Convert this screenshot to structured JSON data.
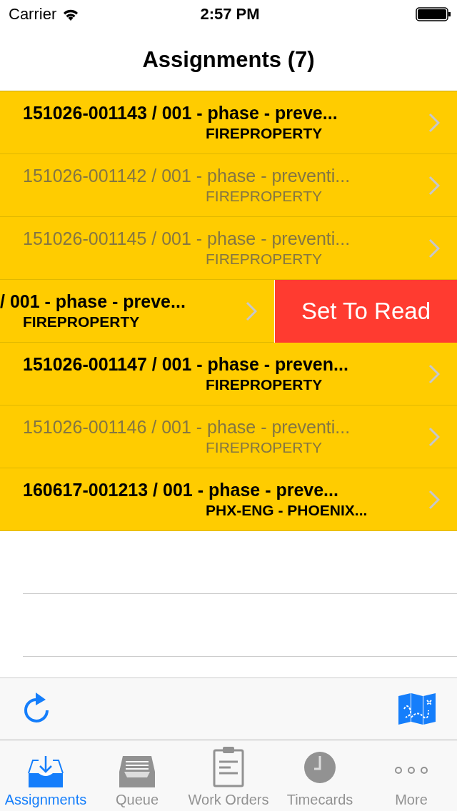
{
  "status_bar": {
    "carrier": "Carrier",
    "time": "2:57 PM"
  },
  "nav": {
    "title": "Assignments (7)"
  },
  "rows": [
    {
      "kind": "normal",
      "title": "151026-001143 / 001 - phase - preve...",
      "subtitle": "FIREPROPERTY",
      "read": false
    },
    {
      "kind": "normal",
      "title": "151026-001142 / 001 - phase - preventi...",
      "subtitle": "FIREPROPERTY",
      "read": true
    },
    {
      "kind": "normal",
      "title": "151026-001145 / 001 - phase - preventi...",
      "subtitle": "FIREPROPERTY",
      "read": true
    },
    {
      "kind": "swiped",
      "title": "/ 001 - phase - preve...",
      "subtitle": "FIREPROPERTY",
      "read": false,
      "action": "Set To Read"
    },
    {
      "kind": "normal",
      "title": "151026-001147 / 001 - phase - preven...",
      "subtitle": "FIREPROPERTY",
      "read": false
    },
    {
      "kind": "normal",
      "title": "151026-001146 / 001 - phase - preventi...",
      "subtitle": "FIREPROPERTY",
      "read": true
    },
    {
      "kind": "normal",
      "title": "160617-001213 / 001 - phase - preve...",
      "subtitle": "PHX-ENG - PHOENIX...",
      "read": false
    }
  ],
  "tabs": [
    {
      "label": "Assignments",
      "selected": true
    },
    {
      "label": "Queue",
      "selected": false
    },
    {
      "label": "Work Orders",
      "selected": false
    },
    {
      "label": "Timecards",
      "selected": false
    },
    {
      "label": "More",
      "selected": false
    }
  ]
}
